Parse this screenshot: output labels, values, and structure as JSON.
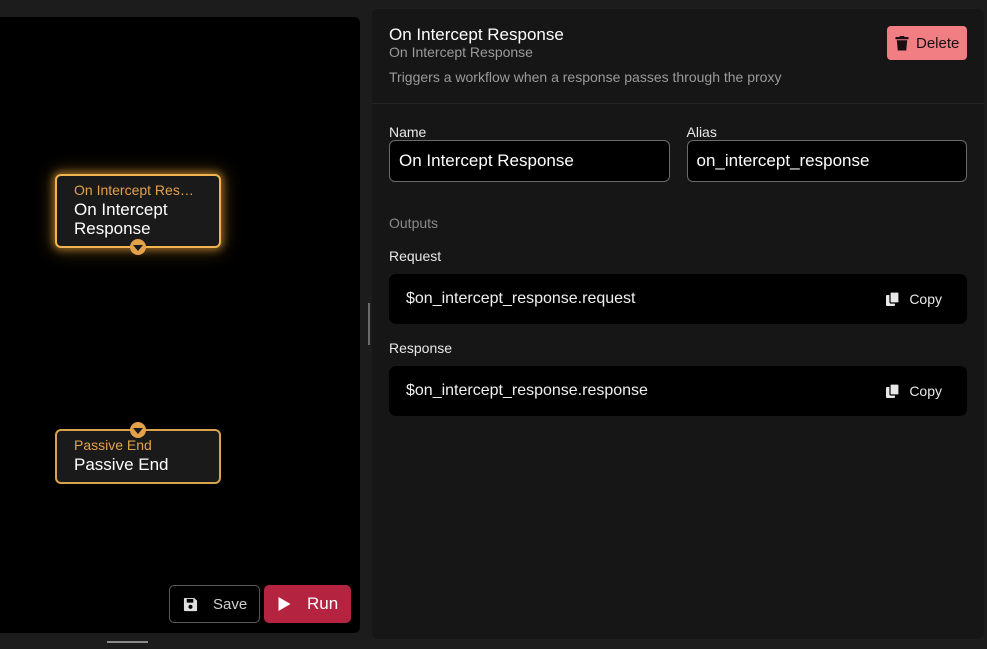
{
  "canvas": {
    "nodes": [
      {
        "type_label": "On Intercept Res…",
        "title": "On Intercept Response"
      },
      {
        "type_label": "Passive End",
        "title": "Passive End"
      }
    ],
    "save_label": "Save",
    "run_label": "Run"
  },
  "panel": {
    "title": "On Intercept Response",
    "subtitle": "On Intercept Response",
    "description": "Triggers a workflow when a response passes through the proxy",
    "delete_label": "Delete",
    "name_label": "Name",
    "name_value": "On Intercept Response",
    "alias_label": "Alias",
    "alias_value": "on_intercept_response",
    "outputs_label": "Outputs",
    "outputs": [
      {
        "label": "Request",
        "value": "$on_intercept_response.request",
        "copy_label": "Copy"
      },
      {
        "label": "Response",
        "value": "$on_intercept_response.response",
        "copy_label": "Copy"
      }
    ]
  },
  "colors": {
    "node_border": "#d9a24d",
    "node_type_text": "#e3a24a",
    "run_button": "#b4233f",
    "delete_button": "#f07e82"
  },
  "icons": {
    "save": "floppy-disk-icon",
    "run": "play-icon",
    "delete": "trash-icon",
    "copy": "copy-icon"
  }
}
